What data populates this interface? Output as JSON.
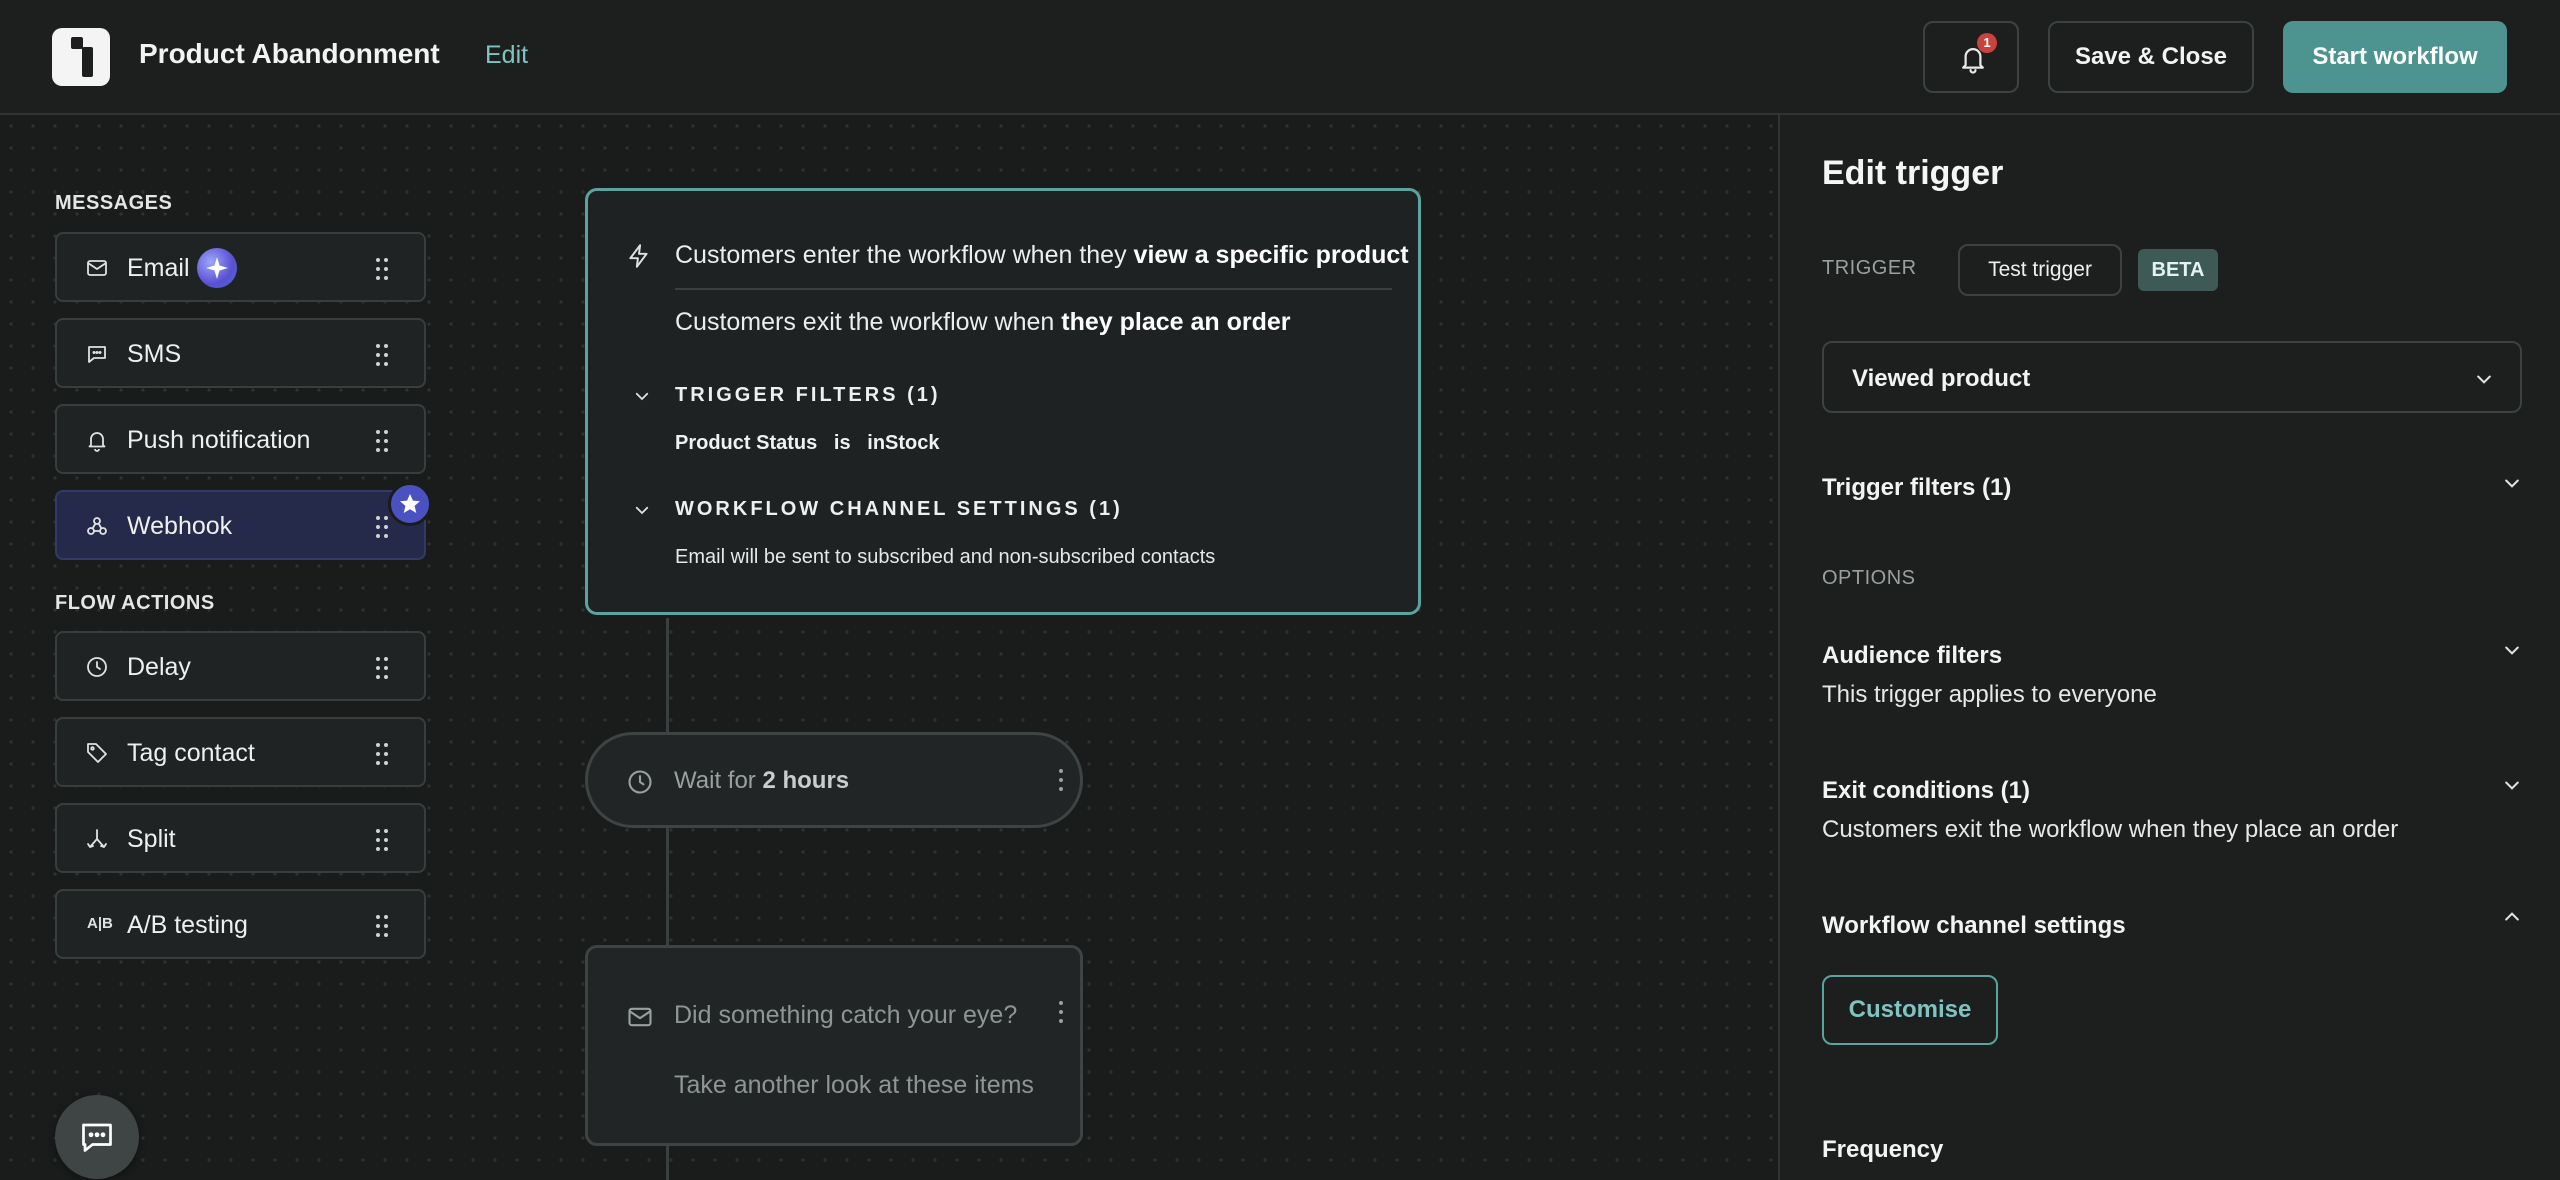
{
  "header": {
    "workflow_title": "Product Abandonment",
    "edit_label": "Edit",
    "notification_count": "1",
    "save_close_label": "Save & Close",
    "start_label": "Start workflow"
  },
  "palette": {
    "messages_heading": "MESSAGES",
    "messages": [
      {
        "label": "Email",
        "icon": "mail-icon"
      },
      {
        "label": "SMS",
        "icon": "chat-bubble-icon"
      },
      {
        "label": "Push notification",
        "icon": "bell-icon"
      },
      {
        "label": "Webhook",
        "icon": "webhook-icon"
      }
    ],
    "flow_heading": "FLOW ACTIONS",
    "flow_actions": [
      {
        "label": "Delay",
        "icon": "clock-icon"
      },
      {
        "label": "Tag contact",
        "icon": "tag-icon"
      },
      {
        "label": "Split",
        "icon": "split-icon"
      },
      {
        "label": "A/B testing",
        "icon": "ab-icon",
        "icon_text": "A|B"
      }
    ]
  },
  "trigger_node": {
    "enter_prefix": "Customers enter the workflow when they ",
    "enter_bold": "view a specific product",
    "exit_prefix": "Customers exit the workflow when ",
    "exit_bold": "they place an order",
    "filters_heading": "TRIGGER FILTERS (1)",
    "filter_line": "Product Status   is   inStock",
    "channel_heading": "WORKFLOW CHANNEL SETTINGS (1)",
    "channel_line": "Email will be sent to subscribed and non-subscribed contacts"
  },
  "wait_node": {
    "prefix": "Wait for ",
    "duration": "2 hours"
  },
  "email_node": {
    "subject": "Did something catch your eye?",
    "preview": "Take another look at these items"
  },
  "panel": {
    "title": "Edit trigger",
    "trigger_label": "TRIGGER",
    "test_trigger_label": "Test trigger",
    "beta_label": "BETA",
    "trigger_event": "Viewed product",
    "trigger_filters_label": "Trigger filters (1)",
    "options_label": "OPTIONS",
    "audience_title": "Audience filters",
    "audience_sub": "This trigger applies to everyone",
    "exit_title": "Exit conditions (1)",
    "exit_sub": "Customers exit the workflow when they place an order",
    "channel_title": "Workflow channel settings",
    "customise_label": "Customise",
    "frequency_title": "Frequency"
  },
  "colors": {
    "accent": "#4d9490",
    "accent_text": "#7fc4c0",
    "background": "#1a1c1c",
    "notification_badge": "#c8423e",
    "webhook_highlight": "#262a4a"
  }
}
